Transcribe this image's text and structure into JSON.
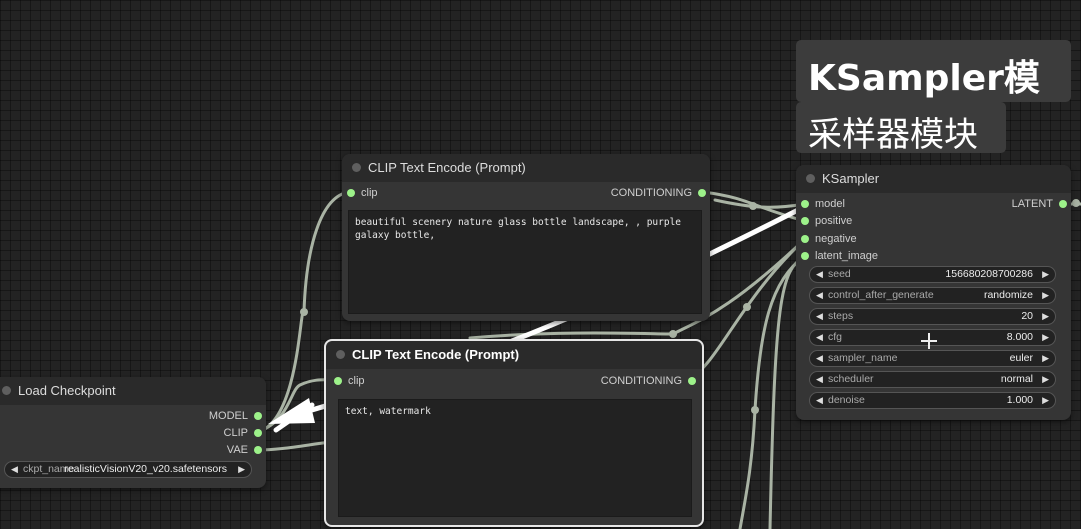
{
  "banners": {
    "line1": "KSampler模块",
    "line2": "采样器模块"
  },
  "clip_top": {
    "title": "CLIP Text Encode (Prompt)",
    "input": "clip",
    "output": "CONDITIONING",
    "text": "beautiful scenery nature glass bottle landscape, , purple galaxy bottle,"
  },
  "clip_bottom": {
    "title": "CLIP Text Encode (Prompt)",
    "input": "clip",
    "output": "CONDITIONING",
    "text": "text, watermark"
  },
  "load_checkpoint": {
    "title": "Load Checkpoint",
    "outputs": [
      "MODEL",
      "CLIP",
      "VAE"
    ],
    "ckpt_label": "ckpt_name",
    "ckpt_value": "realisticVisionV20_v20.safetensors"
  },
  "ksampler": {
    "title": "KSampler",
    "inputs": [
      "model",
      "positive",
      "negative",
      "latent_image"
    ],
    "output": "LATENT",
    "widgets": [
      {
        "label": "seed",
        "value": "156680208700286"
      },
      {
        "label": "control_after_generate",
        "value": "randomize"
      },
      {
        "label": "steps",
        "value": "20"
      },
      {
        "label": "cfg",
        "value": "8.000"
      },
      {
        "label": "sampler_name",
        "value": "euler"
      },
      {
        "label": "scheduler",
        "value": "normal"
      },
      {
        "label": "denoise",
        "value": "1.000"
      }
    ]
  },
  "colors": {
    "canvas": "#232323",
    "node_body": "#353535",
    "node_title": "#2a2a2a",
    "pin_connected": "#9df28a",
    "wire": "#a9b3a4",
    "annotation_arrow": "#ffffff"
  },
  "icons": {
    "arrow_left": "◀",
    "arrow_right": "▶"
  }
}
